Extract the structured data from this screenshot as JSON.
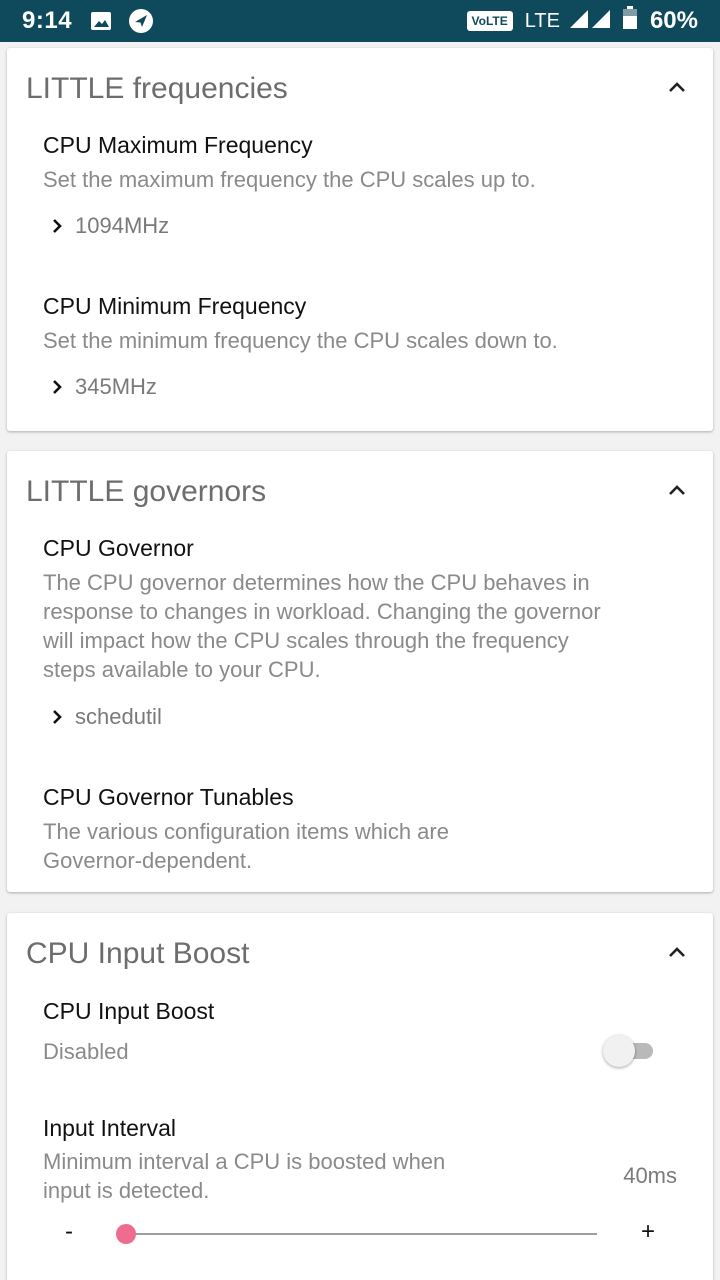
{
  "status_bar": {
    "time": "9:14",
    "volte": "VoLTE",
    "network": "LTE",
    "battery": "60%",
    "icons": [
      "image-icon",
      "navigation-icon",
      "signal-icon",
      "battery-icon"
    ]
  },
  "cards": [
    {
      "title": "LITTLE frequencies",
      "items": [
        {
          "title": "CPU Maximum Frequency",
          "desc": "Set the maximum frequency the CPU scales up to.",
          "value": "1094MHz"
        },
        {
          "title": "CPU Minimum Frequency",
          "desc": "Set the minimum frequency the CPU scales down to.",
          "value": "345MHz"
        }
      ]
    },
    {
      "title": "LITTLE governors",
      "items": [
        {
          "title": "CPU Governor",
          "desc_lines": [
            "The CPU governor determines how the CPU behaves in",
            "response to changes in workload. Changing the governor",
            "will impact how the CPU scales through the frequency",
            "steps available to your CPU."
          ],
          "value": "schedutil"
        },
        {
          "title": "CPU Governor Tunables",
          "desc_lines": [
            "The various configuration items which are",
            "Governor-dependent."
          ]
        }
      ]
    },
    {
      "title": "CPU Input Boost",
      "items": [
        {
          "title": "CPU Input Boost",
          "status": "Disabled",
          "enabled": false
        },
        {
          "title": "Input Interval",
          "desc_lines": [
            "Minimum interval a CPU is boosted when",
            "input is detected."
          ],
          "value": "40ms",
          "slider_fraction": 0.0,
          "minus": "-",
          "plus": "+"
        }
      ]
    }
  ],
  "colors": {
    "status_bar": "#0f4a5c",
    "accent": "#ee6d8f",
    "card": "#ffffff",
    "background": "#f2f2f2"
  }
}
